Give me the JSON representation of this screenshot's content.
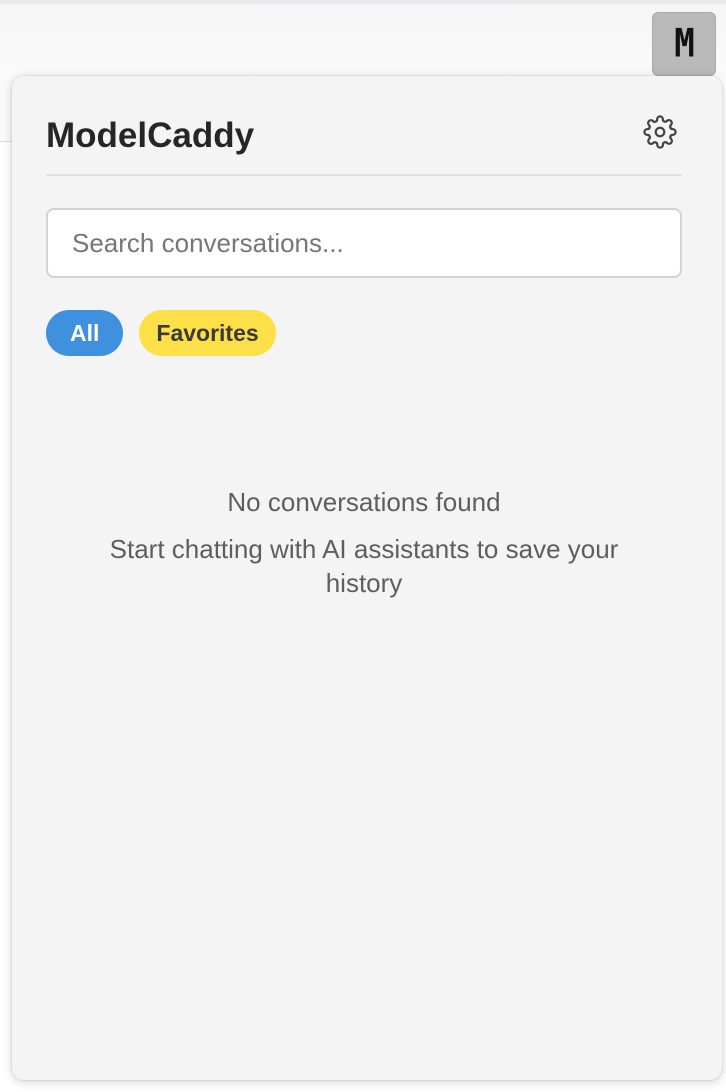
{
  "browser": {
    "extension_button": {
      "glyph": "M",
      "icon": "extension-m-icon"
    }
  },
  "popup": {
    "title": "ModelCaddy",
    "settings_icon": "gear-icon",
    "search": {
      "placeholder": "Search conversations...",
      "value": ""
    },
    "filters": [
      {
        "label": "All",
        "selected": true,
        "color": "#3f90df"
      },
      {
        "label": "Favorites",
        "selected": false,
        "color": "#fde048"
      }
    ],
    "empty_state": {
      "title": "No conversations found",
      "subtitle": "Start chatting with AI assistants to save your history"
    }
  }
}
